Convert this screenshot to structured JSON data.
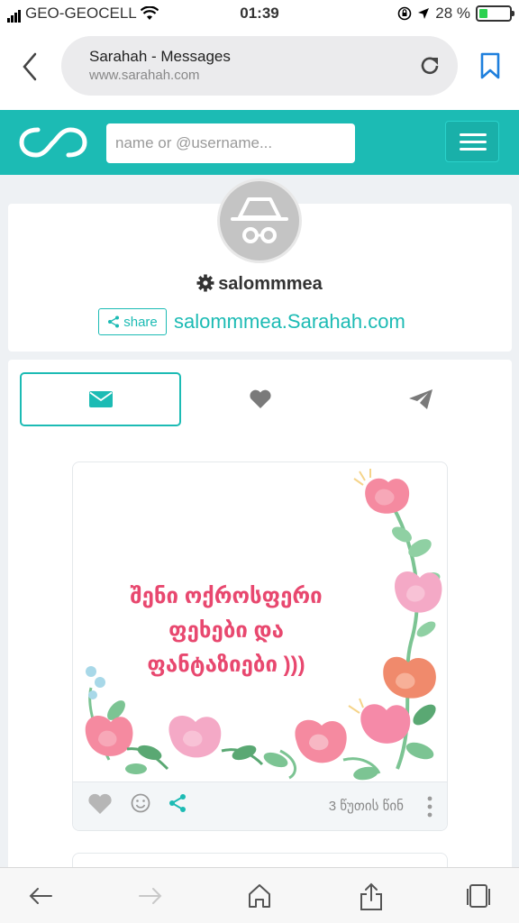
{
  "status_bar": {
    "carrier": "GEO-GEOCELL",
    "time": "01:39",
    "battery_percent": "28 %",
    "battery_level": 0.28
  },
  "browser": {
    "page_title": "Sarahah - Messages",
    "url": "www.sarahah.com"
  },
  "navbar": {
    "search_placeholder": "name or @username..."
  },
  "profile": {
    "username": "salommmea",
    "share_label": "share",
    "profile_link": "salommmea.Sarahah.com"
  },
  "tabs": [
    {
      "name": "received",
      "icon": "envelope-icon",
      "active": true
    },
    {
      "name": "favorites",
      "icon": "heart-icon",
      "active": false
    },
    {
      "name": "sent",
      "icon": "paper-plane-icon",
      "active": false
    }
  ],
  "message_card": {
    "text_line1": "შენი ოქროსფერი",
    "text_line2": "ფეხები და",
    "text_line3": "ფანტაზიები )))",
    "time_ago": "3 წუთის წინ"
  },
  "colors": {
    "brand": "#1cbbb4",
    "message_text": "#e8486f",
    "battery": "#2bd14f"
  }
}
